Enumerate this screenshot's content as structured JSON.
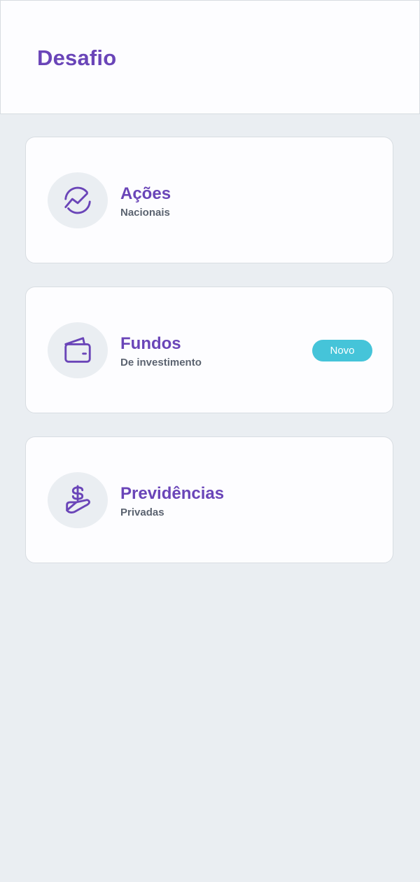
{
  "header": {
    "title": "Desafio"
  },
  "cards": [
    {
      "title": "Ações",
      "subtitle": "Nacionais",
      "icon": "chart-circle-icon"
    },
    {
      "title": "Fundos",
      "subtitle": "De investimento",
      "icon": "wallet-icon",
      "badge": "Novo"
    },
    {
      "title": "Previdências",
      "subtitle": "Privadas",
      "icon": "dollar-hand-icon"
    }
  ],
  "colors": {
    "accent": "#6a45b8",
    "badge": "#45c4d9",
    "background": "#eaeef2",
    "subtitle": "#5b6370"
  }
}
